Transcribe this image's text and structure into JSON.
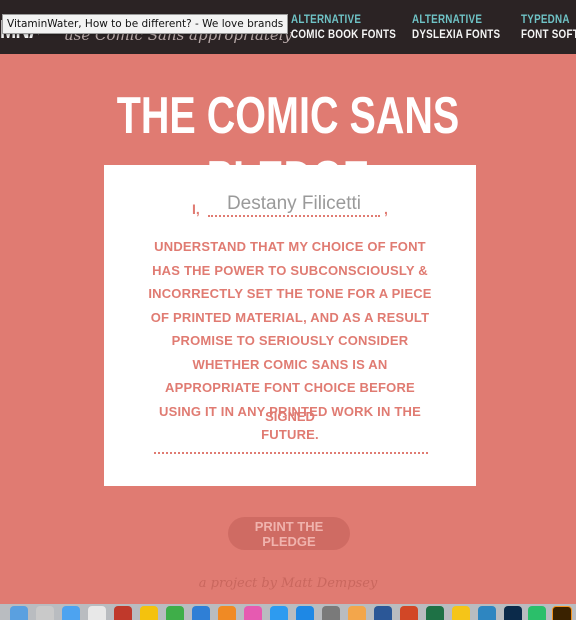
{
  "header": {
    "logo_fragment": "MNAL",
    "tagline": "use Comic Sans appropriately",
    "tooltip": "VitaminWater, How to be different? - We love brands",
    "nav": [
      {
        "line1": "ALTERNATIVE",
        "line2": "COMIC BOOK FONTS"
      },
      {
        "line1": "ALTERNATIVE",
        "line2": "DYSLEXIA FONTS"
      },
      {
        "line1": "TYPEDNA",
        "line2": "FONT SOFTW"
      }
    ]
  },
  "main": {
    "title": "THE COMIC SANS PLEDGE",
    "pledge_prefix": "I,",
    "name_value": "Destany Filicetti",
    "pledge_suffix": ",",
    "pledge_text": "UNDERSTAND THAT MY CHOICE OF FONT HAS THE POWER TO SUBCONSCIOUSLY & INCORRECTLY SET THE TONE FOR A PIECE OF PRINTED MATERIAL, AND AS A RESULT PROMISE TO SERIOUSLY CONSIDER WHETHER COMIC SANS IS AN APPROPRIATE FONT CHOICE BEFORE USING IT IN ANY PRINTED WORK IN THE FUTURE.",
    "signed_label": "SIGNED",
    "print_button": "PRINT THE PLEDGE",
    "credit": "a project by Matt Dempsey"
  },
  "colors": {
    "background": "#e07b72",
    "header_bg": "#2b2324",
    "nav_accent": "#6fc3c6",
    "card_bg": "#ffffff",
    "button_bg": "#cf6b63"
  },
  "dock": {
    "icons": [
      "finder-icon",
      "launchpad-icon",
      "notes-icon",
      "calendar-icon",
      "photo-booth-icon",
      "chrome-icon",
      "numbers-icon",
      "keynote-icon",
      "preview-icon",
      "itunes-icon",
      "safari-icon",
      "app-store-icon",
      "system-preferences-icon",
      "photos-icon",
      "word-icon",
      "powerpoint-icon",
      "excel-icon",
      "outlook-icon",
      "globe-icon",
      "photoshop-icon",
      "chrome-alt-icon",
      "illustrator-icon"
    ]
  }
}
